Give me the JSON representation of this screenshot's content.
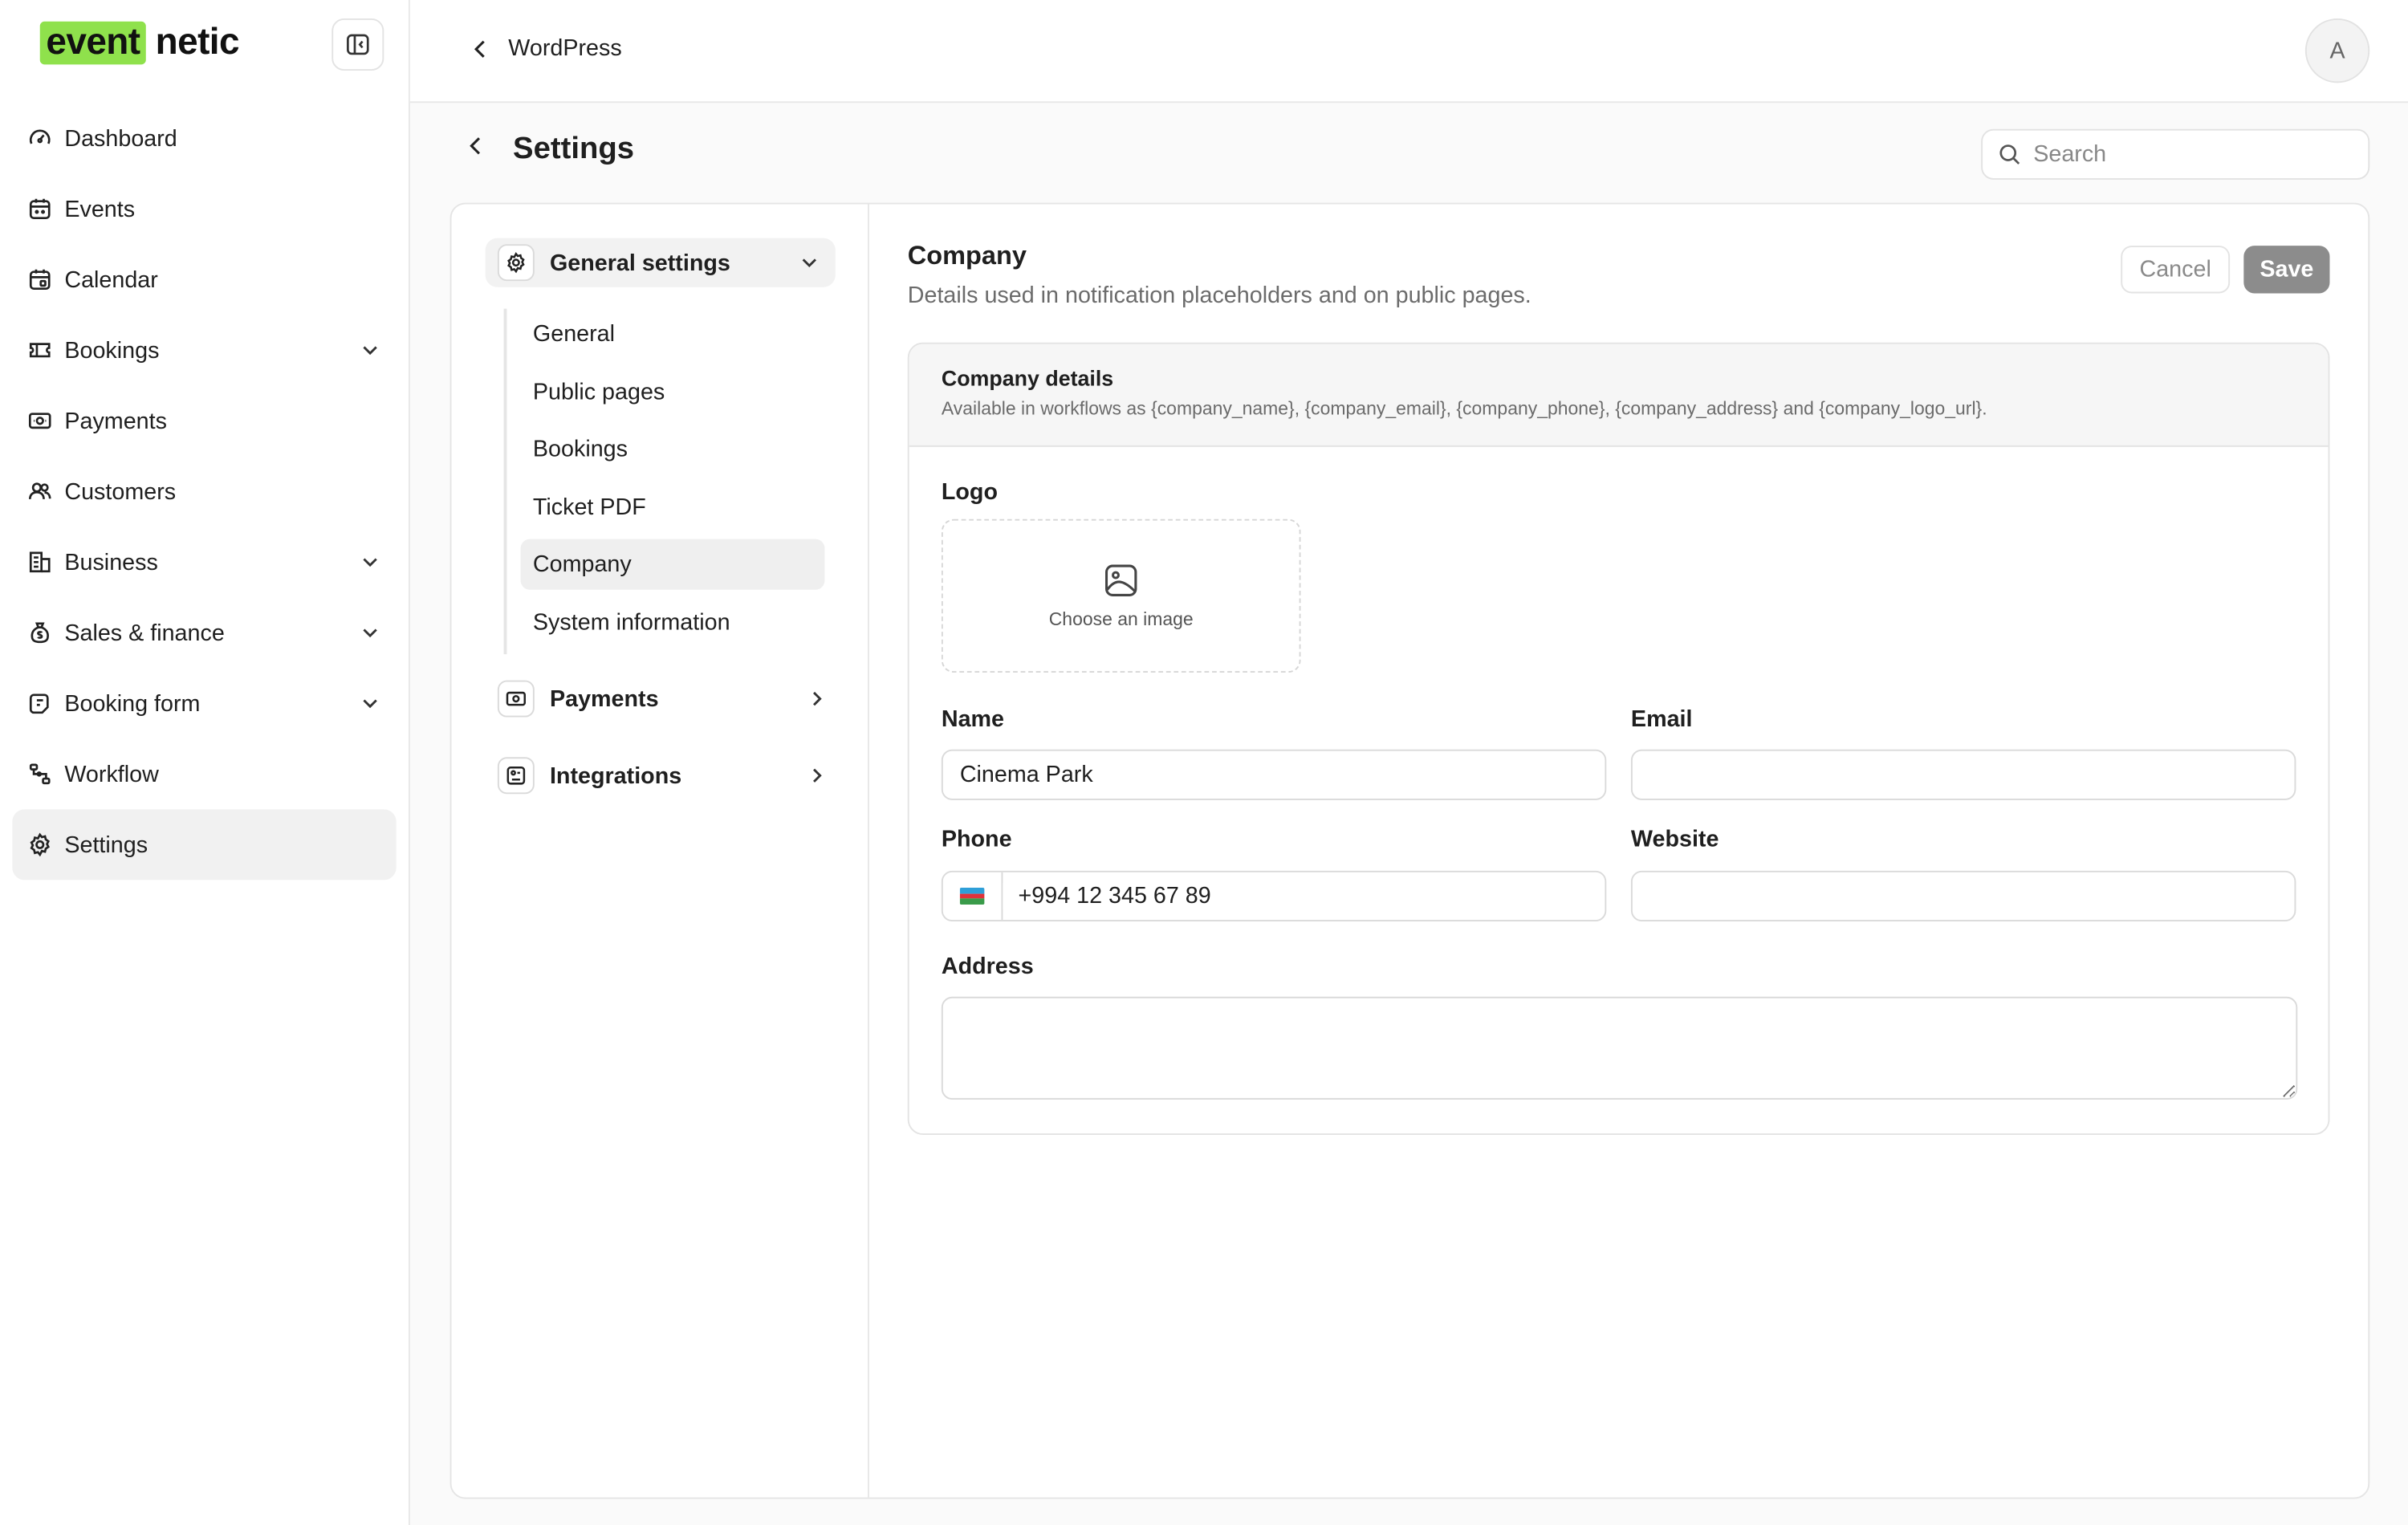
{
  "brand": {
    "logo_highlight": "event",
    "logo_rest": "netic",
    "accent": "#8fe14c"
  },
  "sidebar": {
    "items": [
      {
        "label": "Dashboard",
        "icon": "dashboard-icon",
        "expandable": false,
        "active": false
      },
      {
        "label": "Events",
        "icon": "calendar-icon",
        "expandable": false,
        "active": false
      },
      {
        "label": "Calendar",
        "icon": "calendar-icon",
        "expandable": false,
        "active": false
      },
      {
        "label": "Bookings",
        "icon": "ticket-icon",
        "expandable": true,
        "active": false
      },
      {
        "label": "Payments",
        "icon": "money-icon",
        "expandable": false,
        "active": false
      },
      {
        "label": "Customers",
        "icon": "users-icon",
        "expandable": false,
        "active": false
      },
      {
        "label": "Business",
        "icon": "building-icon",
        "expandable": true,
        "active": false
      },
      {
        "label": "Sales & finance",
        "icon": "money-bag-icon",
        "expandable": true,
        "active": false
      },
      {
        "label": "Booking form",
        "icon": "form-icon",
        "expandable": true,
        "active": false
      },
      {
        "label": "Workflow",
        "icon": "workflow-icon",
        "expandable": false,
        "active": false
      },
      {
        "label": "Settings",
        "icon": "gear-icon",
        "expandable": false,
        "active": true
      }
    ]
  },
  "topbar": {
    "breadcrumb": "WordPress",
    "avatar_initial": "A"
  },
  "page": {
    "title": "Settings",
    "search_placeholder": "Search"
  },
  "settings_nav": {
    "general_group": "General settings",
    "sub_items": [
      {
        "label": "General",
        "active": false
      },
      {
        "label": "Public pages",
        "active": false
      },
      {
        "label": "Bookings",
        "active": false
      },
      {
        "label": "Ticket PDF",
        "active": false
      },
      {
        "label": "Company",
        "active": true
      },
      {
        "label": "System information",
        "active": false
      }
    ],
    "payments_group": "Payments",
    "integrations_group": "Integrations"
  },
  "content": {
    "title": "Company",
    "description": "Details used in notification placeholders and on public pages.",
    "cancel_label": "Cancel",
    "save_label": "Save",
    "card": {
      "title": "Company details",
      "subtitle": "Available in workflows as {company_name}, {company_email}, {company_phone}, {company_address} and {company_logo_url}.",
      "logo_label": "Logo",
      "logo_choose": "Choose an image",
      "name_label": "Name",
      "name_value": "Cinema Park",
      "email_label": "Email",
      "email_value": "",
      "phone_label": "Phone",
      "phone_value": "+994 12 345 67 89",
      "phone_country": "Azerbaijan",
      "website_label": "Website",
      "website_value": "",
      "address_label": "Address",
      "address_value": ""
    }
  }
}
